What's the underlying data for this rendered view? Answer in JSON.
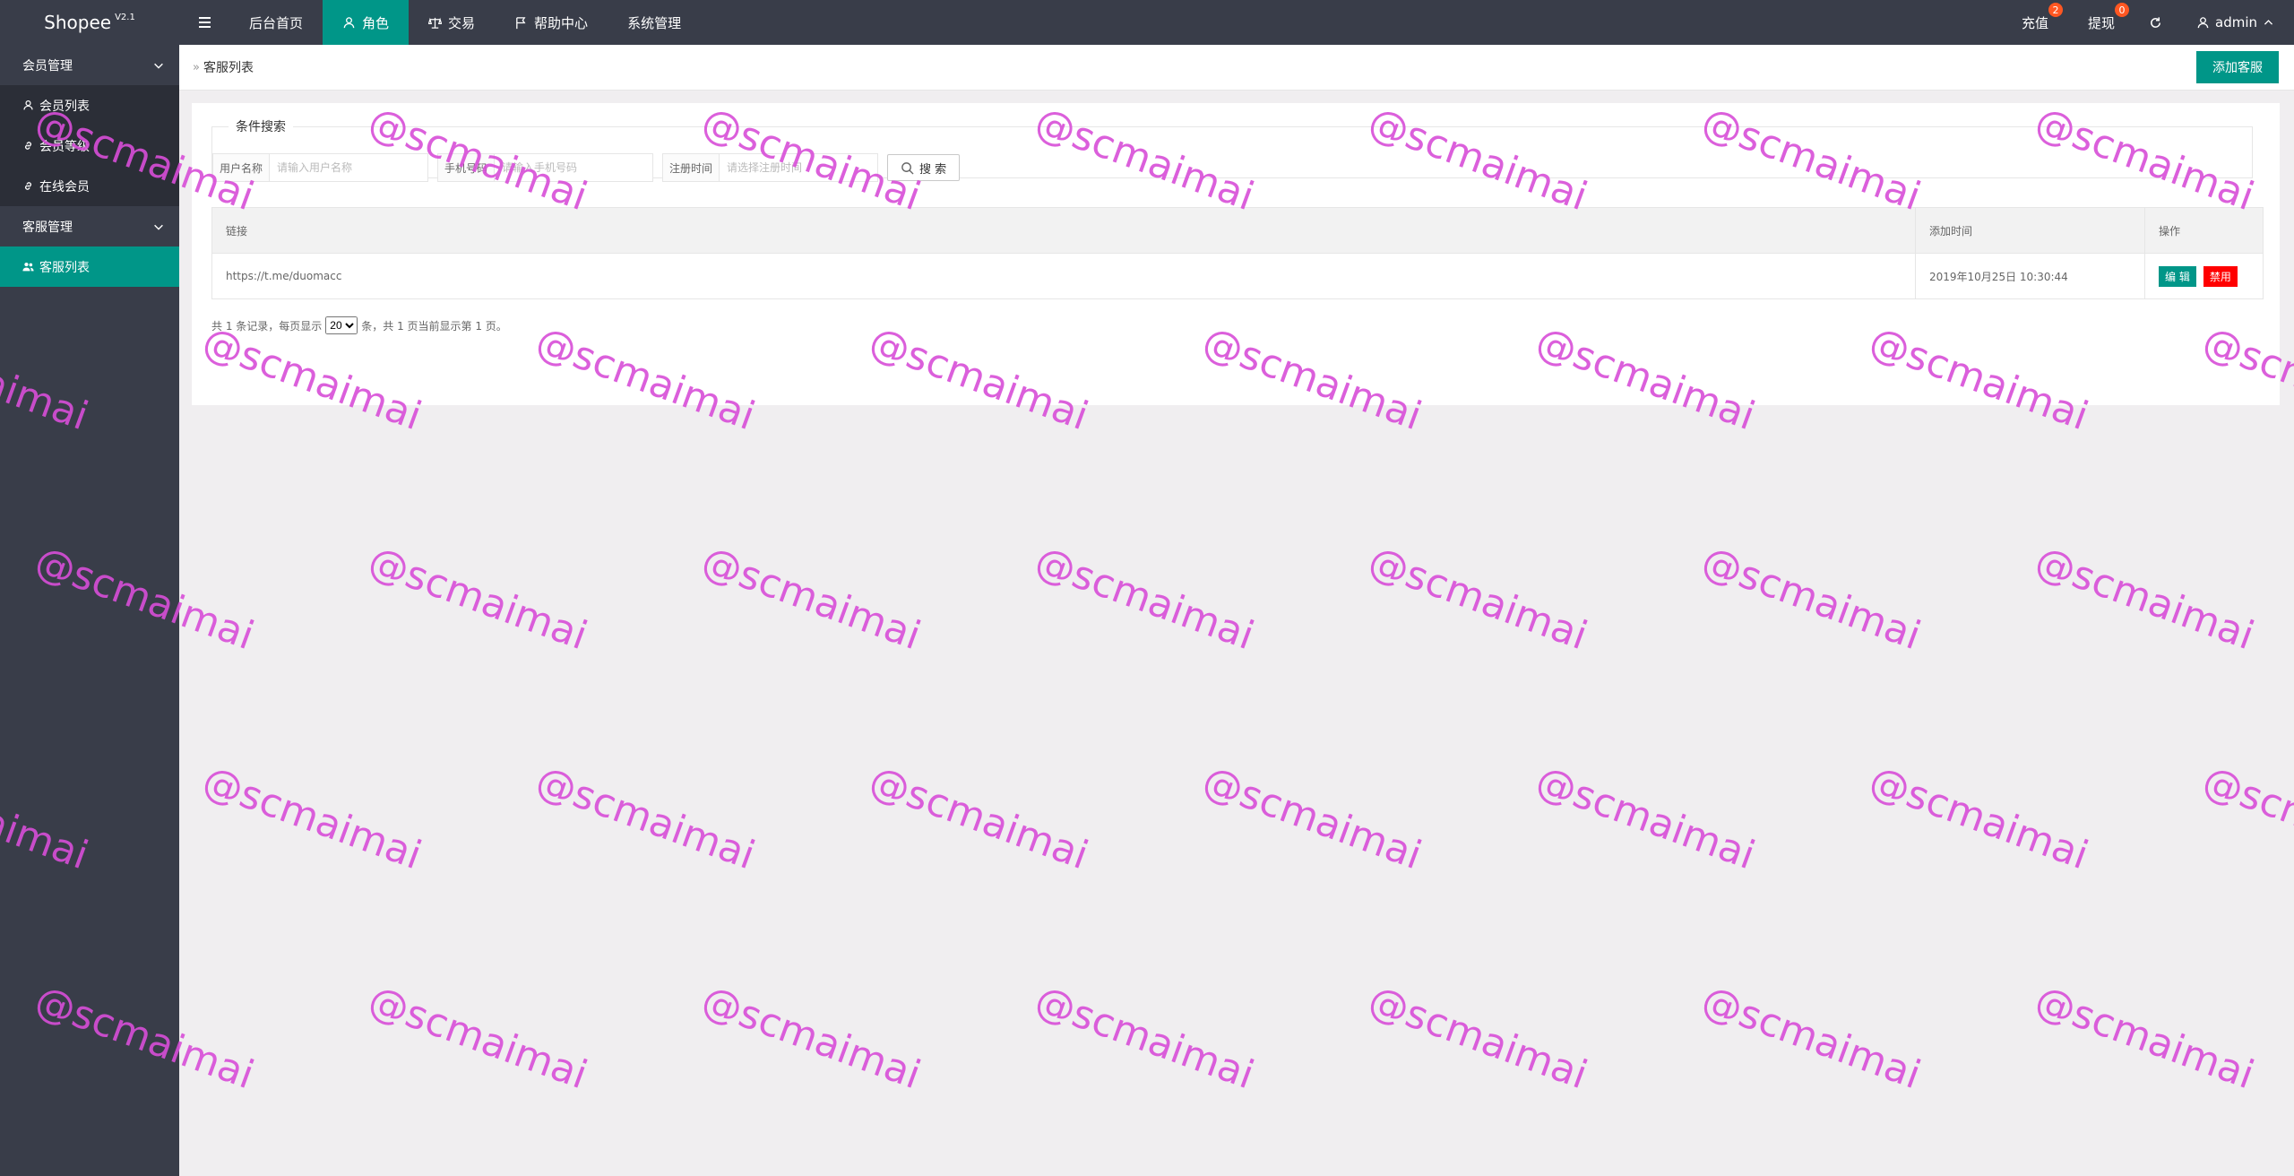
{
  "app": {
    "name": "Shopee",
    "version": "V2.1"
  },
  "topnav": [
    {
      "label": "后台首页",
      "icon": "",
      "active": false
    },
    {
      "label": "角色",
      "icon": "user-icon",
      "active": true
    },
    {
      "label": "交易",
      "icon": "scale-icon",
      "active": false
    },
    {
      "label": "帮助中心",
      "icon": "flag-icon",
      "active": false
    },
    {
      "label": "系统管理",
      "icon": "",
      "active": false
    }
  ],
  "topright": {
    "recharge": {
      "label": "充值",
      "badge": "2"
    },
    "withdraw": {
      "label": "提现",
      "badge": "0"
    },
    "refresh_icon": "refresh-icon",
    "user": {
      "name": "admin"
    }
  },
  "sidebar": {
    "groups": [
      {
        "label": "会员管理",
        "items": [
          {
            "label": "会员列表",
            "icon": "user-icon"
          },
          {
            "label": "会员等级",
            "icon": "link-icon"
          },
          {
            "label": "在线会员",
            "icon": "link-icon"
          }
        ]
      },
      {
        "label": "客服管理",
        "items": [
          {
            "label": "客服列表",
            "icon": "users-icon",
            "active": true
          }
        ]
      }
    ]
  },
  "breadcrumb": {
    "current": "客服列表"
  },
  "add_button": "添加客服",
  "search": {
    "legend": "条件搜索",
    "username": {
      "label": "用户名称",
      "placeholder": "请输入用户名称"
    },
    "phone": {
      "label": "手机号码",
      "placeholder": "请输入手机号码"
    },
    "regtime": {
      "label": "注册时间",
      "placeholder": "请选择注册时间"
    },
    "button": "搜 索"
  },
  "table": {
    "headers": {
      "link": "链接",
      "time": "添加时间",
      "ops": "操作"
    },
    "rows": [
      {
        "link": "https://t.me/duomacc",
        "time": "2019年10月25日 10:30:44",
        "edit": "编 辑",
        "ban": "禁用"
      }
    ]
  },
  "pager": {
    "prefix": "共 1 条记录，每页显示",
    "page_size": "20",
    "suffix": "条，共 1 页当前显示第 1 页。"
  },
  "watermark": "@scmaimai"
}
